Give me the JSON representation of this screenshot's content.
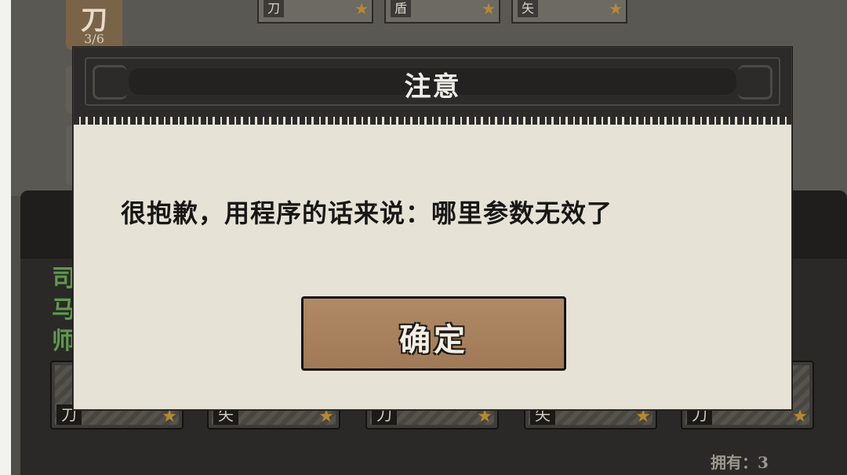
{
  "dialog": {
    "title": "注意",
    "message": "很抱歉，用程序的话来说：哪里参数无效了",
    "confirm_label": "确定"
  },
  "background": {
    "top_slots": [
      {
        "tag": "刀"
      },
      {
        "tag": "盾"
      },
      {
        "tag": "矢"
      }
    ],
    "blade_badge": {
      "glyph": "刀",
      "count": "3/6"
    },
    "general_name": "司马师",
    "unit_cards": [
      {
        "tag": "刀"
      },
      {
        "tag": "矢"
      },
      {
        "tag": "刀"
      },
      {
        "tag": "矢"
      },
      {
        "tag": "刀"
      }
    ],
    "owned": "拥有：3"
  },
  "icons": {
    "star": "star-icon"
  },
  "colors": {
    "dialog_paper": "#e6e2d6",
    "dialog_header": "#2c2b29",
    "button_brown": "#a88260",
    "star_gold": "#b8892e",
    "general_green": "#5f9a4e"
  }
}
